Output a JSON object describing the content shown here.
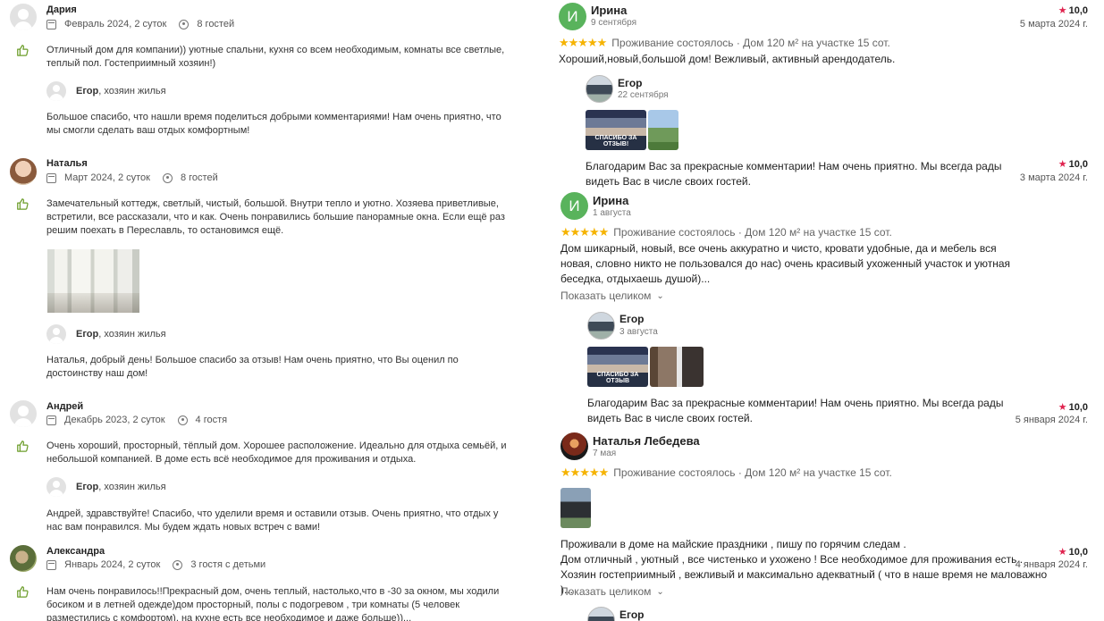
{
  "left_reviews": [
    {
      "name": "Дария",
      "stay": "Февраль 2024, 2 суток",
      "guests": "8 гостей",
      "rating": "10,0",
      "date": "5 марта 2024 г.",
      "text": "Отличный дом для компании)) уютные спальни, кухня со всем необходимым, комнаты все светлые, теплый пол. Гостеприимный хозяин!)",
      "host_name": "Егор",
      "host_role": ", хозяин жилья",
      "reply": "Большое спасибо, что нашли время поделиться добрыми комментариями! Нам очень приятно, что мы смогли сделать ваш отдых комфортным!"
    },
    {
      "name": "Наталья",
      "stay": "Март 2024, 2 суток",
      "guests": "8 гостей",
      "rating": "10,0",
      "date": "3 марта 2024 г.",
      "text": "Замечательный коттедж, светлый, чистый, большой. Внутри тепло и уютно. Хозяева приветливые, встретили, все рассказали, что и как. Очень понравились большие панорамные окна. Если ещё раз решим поехать в Переславль, то остановимся ещё.",
      "host_name": "Егор",
      "host_role": ", хозяин жилья",
      "reply": "Наталья, добрый день! Большое спасибо за отзыв! Нам очень приятно, что Вы оценил по достоинству наш дом!"
    },
    {
      "name": "Андрей",
      "stay": "Декабрь 2023, 2 суток",
      "guests": "4 гостя",
      "rating": "10,0",
      "date": "5 января 2024 г.",
      "text": "Очень хороший, просторный, тёплый дом. Хорошее расположение. Идеально для отдыха семьёй, и небольшой компанией. В доме есть всё необходимое для проживания и отдыха.",
      "host_name": "Егор",
      "host_role": ", хозяин жилья",
      "reply": "Андрей, здравствуйте! Спасибо, что уделили время и оставили отзыв. Очень приятно, что отдых у нас вам понравился. Мы будем ждать новых встреч с вами!"
    },
    {
      "name": "Александра",
      "stay": "Январь 2024, 2 суток",
      "guests": "3 гостя с детьми",
      "rating": "10,0",
      "date": "4 января 2024 г.",
      "text": "Нам очень понравилось!!Прекрасный дом, очень теплый, настолько,что в -30 за окном, мы ходили босиком и в летней одежде)дом просторный, полы с подогревом , три комнаты (5 человек разместились с комфортом), на кухне есть все необходимое и даже больше))..."
    }
  ],
  "right_reviews": [
    {
      "initial": "И",
      "name": "Ирина",
      "when": "9 сентября",
      "stars": "★★★★★",
      "summary": "Проживание состоялось · Дом 120 м² на участке 15 сот.",
      "text": "Хороший,новый,большой дом! Вежливый, активный арендодатель.",
      "owner": "Егор",
      "owner_when": "22 сентября",
      "meme_caption": "СПАСИБО ЗА ОТЗЫВ!",
      "owner_reply": "Благодарим Вас за прекрасные комментарии! Нам очень приятно. Мы всегда рады видеть Вас в числе своих гостей."
    },
    {
      "initial": "И",
      "name": "Ирина",
      "when": "1 августа",
      "stars": "★★★★★",
      "summary": "Проживание состоялось · Дом 120 м² на участке 15 сот.",
      "text": "Дом шикарный, новый, все очень аккуратно и чисто, кровати удобные, да и мебель вся новая, словно никто не пользовался до нас) очень красивый ухоженный участок и уютная беседка, отдыхаешь душой)...",
      "show_all": "Показать целиком",
      "owner": "Егор",
      "owner_when": "3 августа",
      "meme_caption": "СПАСИБО ЗА ОТЗЫВ",
      "owner_reply": "Благодарим Вас за прекрасные комментарии! Нам очень приятно. Мы всегда рады видеть Вас в числе своих гостей."
    },
    {
      "name": "Наталья Лебедева",
      "when": "7 мая",
      "stars": "★★★★★",
      "summary": "Проживание состоялось · Дом 120 м² на участке 15 сот.",
      "text_lines": [
        "Проживали в доме на майские праздники , пишу по горячим следам .",
        "Дом отличный , уютный , все чистенько и ухожено ! Все необходимое для проживания есть .",
        "Хозяин гостеприимный , вежливый и максимально адекватный ( что в наше время не маловажно )..."
      ],
      "show_all": "Показать целиком",
      "owner": "Егор"
    }
  ]
}
